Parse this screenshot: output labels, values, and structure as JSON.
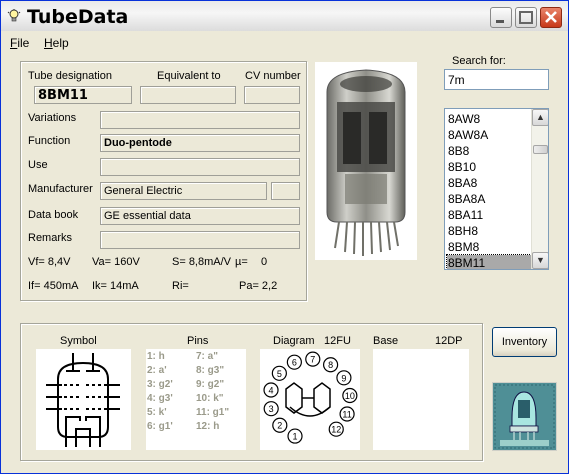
{
  "window": {
    "title": "TubeData"
  },
  "menu": {
    "file": "File",
    "file_key": "F",
    "file_rest": "ile",
    "help": "Help",
    "help_key": "H",
    "help_rest": "elp"
  },
  "headers": {
    "tube_designation": "Tube designation",
    "equivalent_to": "Equivalent to",
    "cv_number": "CV number"
  },
  "fields": {
    "tube_designation": "8BM11",
    "equivalent_to": "",
    "cv_number": "",
    "variations": {
      "label": "Variations",
      "value": ""
    },
    "function": {
      "label": "Function",
      "value": "Duo-pentode"
    },
    "use": {
      "label": "Use",
      "value": ""
    },
    "manufacturer": {
      "label": "Manufacturer",
      "value": "General Electric",
      "code": ""
    },
    "data_book": {
      "label": "Data book",
      "value": "GE essential data"
    },
    "remarks": {
      "label": "Remarks",
      "value": ""
    }
  },
  "specs": {
    "vf": "Vf= 8,4V",
    "va": "Va= 160V",
    "s": "S= 8,8mA/V",
    "mu": "µ=",
    "mu_value": "0",
    "if": "If= 450mA",
    "ik": "Ik= 14mA",
    "ri": "Ri=",
    "pa": "Pa= 2,2"
  },
  "search": {
    "label": "Search for:",
    "value": "7m"
  },
  "tube_list": [
    "8AW8",
    "8AW8A",
    "8B8",
    "8B10",
    "8BA8",
    "8BA8A",
    "8BA11",
    "8BH8",
    "8BM8",
    "8BM11"
  ],
  "selected_tube": "8BM11",
  "bottom": {
    "symbol_label": "Symbol",
    "pins_label": "Pins",
    "diagram_label": "Diagram",
    "diagram_code": "12FU",
    "base_label": "Base",
    "base_code": "12DP"
  },
  "pins": [
    [
      "1: h",
      "7: a\""
    ],
    [
      "2: a'",
      "8: g3\""
    ],
    [
      "3: g2'",
      "9: g2\""
    ],
    [
      "4: g3'",
      "10: k\""
    ],
    [
      "5: k'",
      "11: g1\""
    ],
    [
      "6: g1'",
      "12: h"
    ]
  ],
  "diagram_pins": [
    "1",
    "2",
    "3",
    "4",
    "5",
    "6",
    "7",
    "8",
    "9",
    "10",
    "11",
    "12"
  ],
  "inventory_label": "Inventory",
  "colors": {
    "title_bar": "#f6f6f6",
    "close_button": "#c7391a",
    "selected_item": "#a9a9a9",
    "pins_text": "#9a9a8a"
  },
  "icons": [
    "bulb-icon",
    "minimize-icon",
    "maximize-icon",
    "close-icon",
    "scroll-up-icon",
    "scroll-down-icon"
  ]
}
